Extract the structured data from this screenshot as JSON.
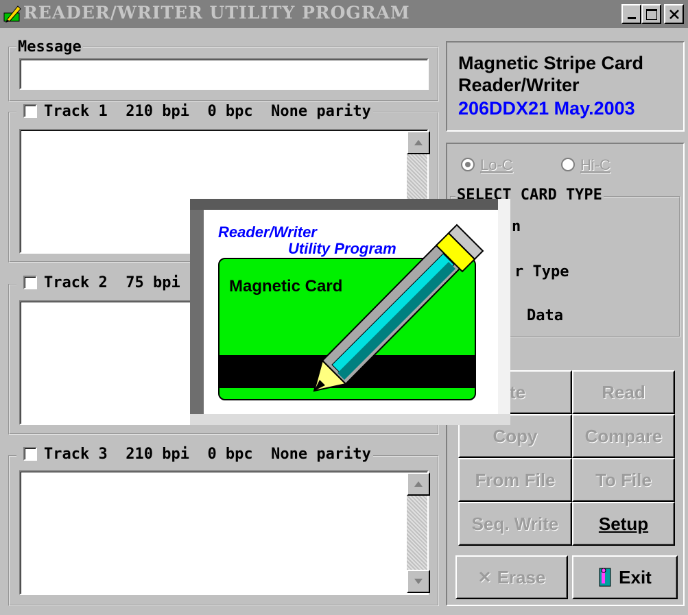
{
  "window": {
    "title": "READER/WRITER UTILITY PROGRAM",
    "controls": {
      "minimize": "_",
      "maximize": "□",
      "close": "×"
    }
  },
  "message": {
    "legend": "Message",
    "value": ""
  },
  "tracks": [
    {
      "label": "Track 1",
      "bpi": "210 bpi",
      "bpc": "0 bpc",
      "parity": "None parity",
      "checked": false,
      "content": ""
    },
    {
      "label": "Track 2",
      "bpi": "75 bpi",
      "checked": false,
      "content": ""
    },
    {
      "label": "Track 3",
      "bpi": "210 bpi",
      "bpc": "0 bpc",
      "parity": "None parity",
      "checked": false,
      "content": ""
    }
  ],
  "device": {
    "line1": "Magnetic Stripe Card",
    "line2": "Reader/Writer",
    "version": "206DDX21 May.2003",
    "version_color": "#0000ff"
  },
  "coercivity": {
    "options": [
      {
        "label": "Lo-C",
        "selected": true
      },
      {
        "label": "Hi-C",
        "selected": false
      }
    ]
  },
  "card_type": {
    "legend": "SELECT CARD TYPE",
    "visible_items": [
      "n",
      "r Type",
      "Data"
    ]
  },
  "buttons": {
    "write": "ite",
    "read": "Read",
    "copy": "Copy",
    "compare": "Compare",
    "from_file": "From File",
    "to_file": "To File",
    "seq_write": "Seq. Write",
    "setup": "Setup",
    "erase": "Erase",
    "exit": "Exit"
  },
  "splash": {
    "line1": "Reader/Writer",
    "line2": "Utility Program",
    "card_label": "Magnetic Card",
    "card_color": "#00f000",
    "text_color": "#0000ff"
  }
}
